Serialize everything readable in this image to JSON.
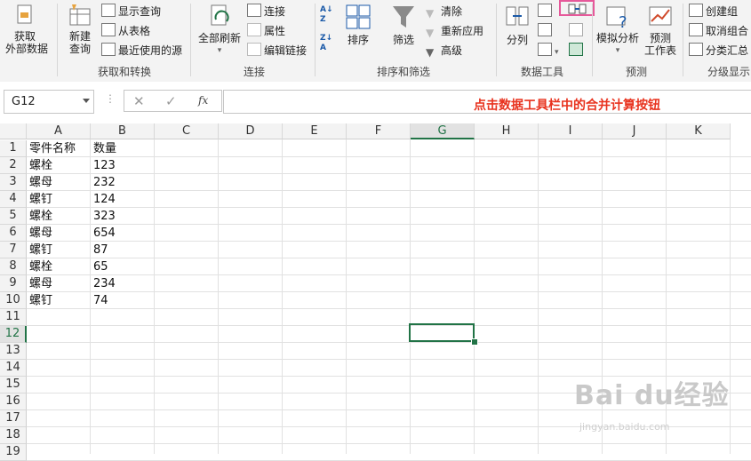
{
  "ribbon": {
    "get_data": {
      "line1": "获取",
      "line2": "外部数据"
    },
    "new_query": {
      "line1": "新建",
      "line2": "查询"
    },
    "show_query": "显示查询",
    "from_table": "从表格",
    "recent_sources": "最近使用的源",
    "group_get_transform": "获取和转换",
    "refresh_all": "全部刷新",
    "connections": "连接",
    "properties": "属性",
    "edit_links": "编辑链接",
    "group_connections": "连接",
    "sort": "排序",
    "filter": "筛选",
    "clear": "清除",
    "reapply": "重新应用",
    "advanced": "高级",
    "group_sort_filter": "排序和筛选",
    "text_to_columns": "分列",
    "group_data_tools": "数据工具",
    "what_if": "模拟分析",
    "forecast_sheet": {
      "line1": "预测",
      "line2": "工作表"
    },
    "group_forecast": "预测",
    "create_group": "创建组",
    "ungroup": "取消组合",
    "subtotal": "分类汇总",
    "group_outline": "分级显示",
    "highlight_color": "#e6599a"
  },
  "formula_bar": {
    "name_box": "G12",
    "fx": "fx",
    "value": ""
  },
  "annotation": "点击数据工具栏中的合并计算按钮",
  "columns": [
    "A",
    "B",
    "C",
    "D",
    "E",
    "F",
    "G",
    "H",
    "I",
    "J",
    "K"
  ],
  "rows": [
    "1",
    "2",
    "3",
    "4",
    "5",
    "6",
    "7",
    "8",
    "9",
    "10",
    "11",
    "12",
    "13",
    "14",
    "15",
    "16",
    "17",
    "18",
    "19"
  ],
  "cells": {
    "A": [
      "零件名称",
      "螺栓",
      "螺母",
      "螺钉",
      "螺栓",
      "螺母",
      "螺钉",
      "螺栓",
      "螺母",
      "螺钉"
    ],
    "B": [
      "数量",
      "123",
      "232",
      "124",
      "323",
      "654",
      "87",
      "65",
      "234",
      "74"
    ]
  },
  "selected_cell": "G12",
  "watermark": {
    "brand": "Bai du经验",
    "url": "jingyan.baidu.com"
  },
  "accent": "#217346"
}
